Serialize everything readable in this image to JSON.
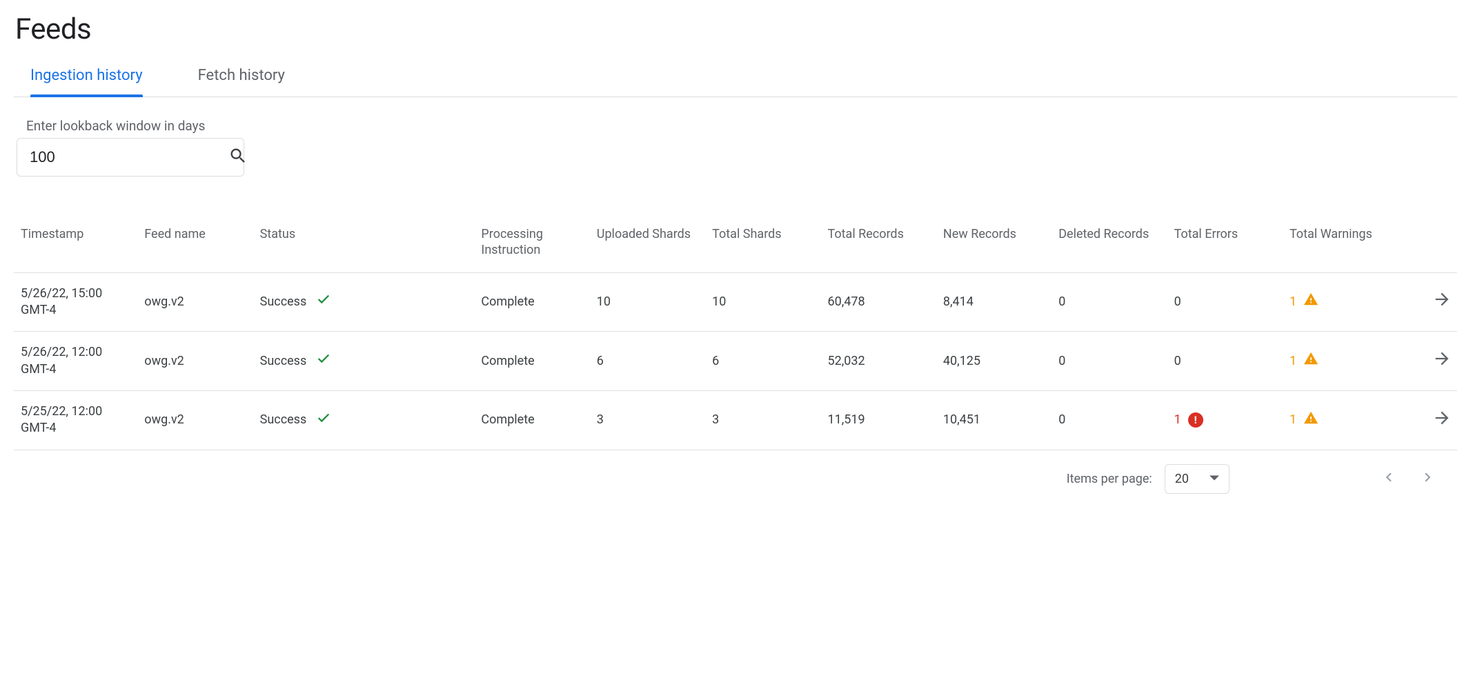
{
  "title": "Feeds",
  "tabs": {
    "ingestion": "Ingestion history",
    "fetch": "Fetch history"
  },
  "lookback": {
    "label": "Enter lookback window in days",
    "value": "100"
  },
  "table": {
    "headers": {
      "timestamp": "Timestamp",
      "feed_name": "Feed name",
      "status": "Status",
      "processing_instruction": "Processing Instruction",
      "uploaded_shards": "Uploaded Shards",
      "total_shards": "Total Shards",
      "total_records": "Total Records",
      "new_records": "New Records",
      "deleted_records": "Deleted Records",
      "total_errors": "Total Errors",
      "total_warnings": "Total Warnings"
    },
    "rows": [
      {
        "timestamp": "5/26/22, 15:00 GMT-4",
        "feed_name": "owg.v2",
        "status": "Success",
        "processing_instruction": "Complete",
        "uploaded_shards": "10",
        "total_shards": "10",
        "total_records": "60,478",
        "new_records": "8,414",
        "deleted_records": "0",
        "total_errors": "0",
        "has_error_badge": false,
        "total_warnings": "1"
      },
      {
        "timestamp": "5/26/22, 12:00 GMT-4",
        "feed_name": "owg.v2",
        "status": "Success",
        "processing_instruction": "Complete",
        "uploaded_shards": "6",
        "total_shards": "6",
        "total_records": "52,032",
        "new_records": "40,125",
        "deleted_records": "0",
        "total_errors": "0",
        "has_error_badge": false,
        "total_warnings": "1"
      },
      {
        "timestamp": "5/25/22, 12:00 GMT-4",
        "feed_name": "owg.v2",
        "status": "Success",
        "processing_instruction": "Complete",
        "uploaded_shards": "3",
        "total_shards": "3",
        "total_records": "11,519",
        "new_records": "10,451",
        "deleted_records": "0",
        "total_errors": "1",
        "has_error_badge": true,
        "total_warnings": "1"
      }
    ]
  },
  "pagination": {
    "label": "Items per page:",
    "value": "20"
  }
}
